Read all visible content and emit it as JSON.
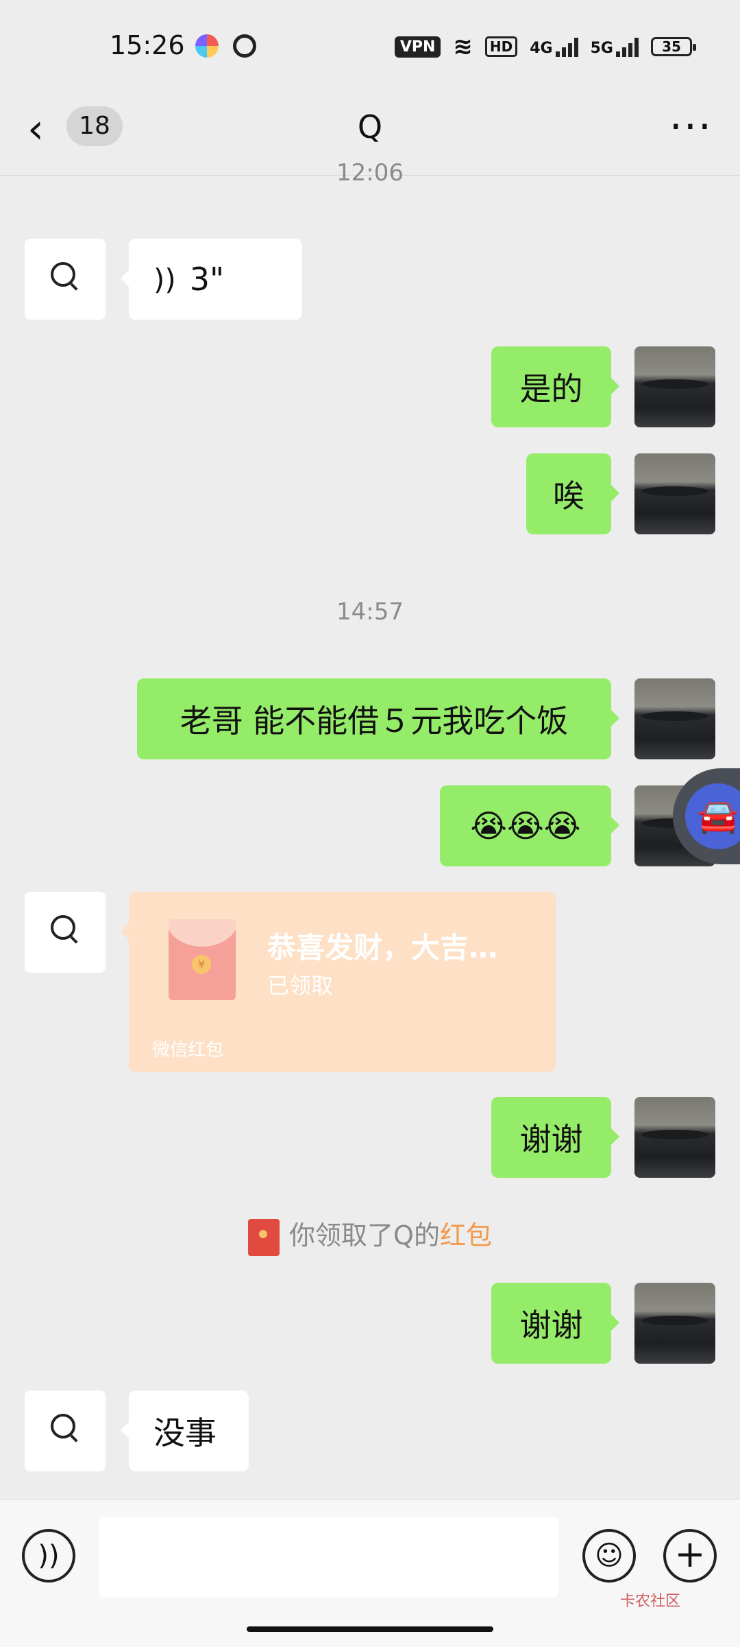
{
  "status_bar": {
    "time": "15:26",
    "vpn": "VPN",
    "hd": "HD",
    "net1": "4G",
    "net2": "5G",
    "battery": "35"
  },
  "nav": {
    "back_icon": "chevron-left",
    "unread_count": "18",
    "title": "Q",
    "more_icon": "ellipsis"
  },
  "messages": {
    "time_top": "12:06",
    "voice_duration": "3\"",
    "m1": "是的",
    "m2": "唉",
    "time_mid": "14:57",
    "m3": "老哥 能不能借５元我吃个饭",
    "m4": "😭😭😭",
    "red_packet": {
      "title": "恭喜发财，大吉…",
      "status": "已领取",
      "footer": "微信红包"
    },
    "m5": "谢谢",
    "system_note_prefix": "你领取了Q的",
    "system_note_link": "红包",
    "m6": "谢谢",
    "m7": "没事"
  },
  "input_bar": {
    "voice_icon": "voice-icon",
    "emoji_icon": "emoji-icon",
    "plus_icon": "plus-icon",
    "watermark": "卡农社区"
  },
  "colors": {
    "background": "#ededed",
    "outgoing_bubble": "#95ec69",
    "incoming_bubble": "#ffffff",
    "red_packet": "#fde0c5",
    "link": "#f2994a"
  }
}
